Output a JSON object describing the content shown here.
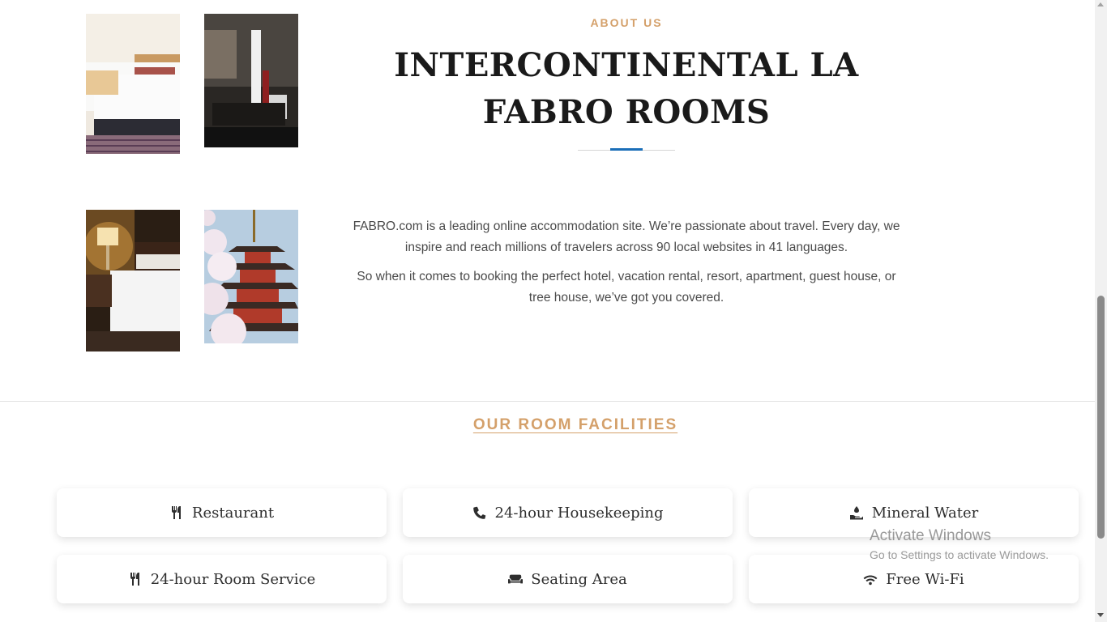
{
  "about": {
    "eyebrow": "ABOUT US",
    "title": "INTERCONTINENTAL LA FABRO ROOMS",
    "paragraphs": [
      "FABRO.com is a leading online accommodation site. We’re passionate about travel. Every day, we inspire and reach millions of travelers across 90 local websites in 41 languages.",
      "So when it comes to booking the perfect hotel, vacation rental, resort, apartment, guest house, or tree house, we’ve got you covered."
    ],
    "divider_accent": "#1a6eb8"
  },
  "facilities": {
    "title": "OUR ROOM FACILITIES",
    "items": [
      {
        "label": "Restaurant",
        "icon": "utensils-icon"
      },
      {
        "label": "24-hour Housekeeping",
        "icon": "phone-icon"
      },
      {
        "label": "Mineral Water",
        "icon": "hand-water-icon"
      },
      {
        "label": "24-hour Room Service",
        "icon": "utensils-icon"
      },
      {
        "label": "Seating Area",
        "icon": "couch-icon"
      },
      {
        "label": "Free Wi-Fi",
        "icon": "wifi-icon"
      }
    ]
  },
  "watermark": {
    "line1": "Activate Windows",
    "line2": "Go to Settings to activate Windows."
  },
  "colors": {
    "accent": "#d4a06a",
    "heading": "#1a1a1a",
    "divider": "#1a6eb8"
  }
}
